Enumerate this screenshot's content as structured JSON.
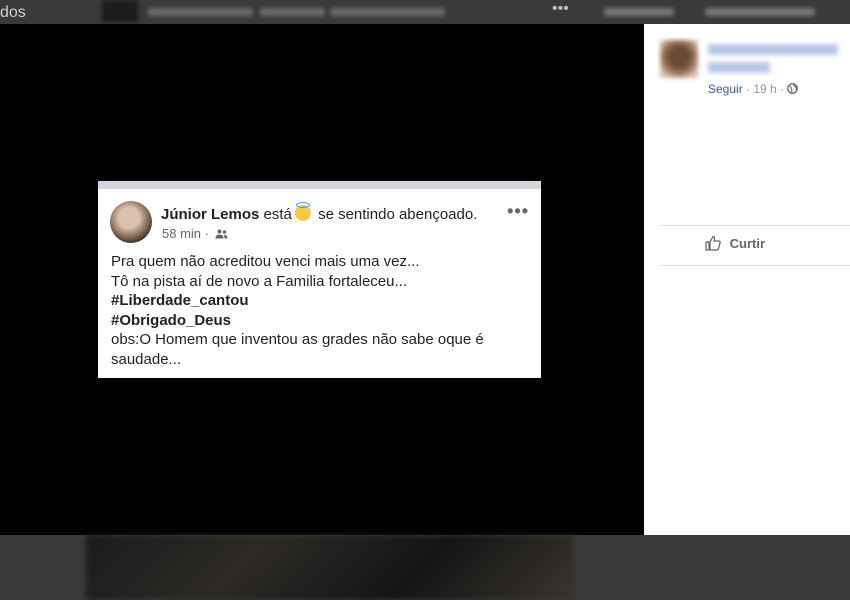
{
  "background": {
    "fragment_text": "dos"
  },
  "post": {
    "author_name": "Júnior Lemos",
    "verb": "está",
    "feeling_emoji": "halo-face-emoji",
    "feeling_text": "se sentindo abençoado.",
    "time": "58 min",
    "separator": "·",
    "audience_icon": "friends-icon",
    "more_label": "•••",
    "lines": [
      "Pra quem não acreditou venci mais uma vez...",
      "Tô na pista aí de novo a Familia fortaleceu..."
    ],
    "hashtags": [
      "#Liberdade_cantou",
      "#Obrigado_Deus"
    ],
    "closing_lines": [
      "obs:O Homem que inventou as grades não sabe oque é",
      "saudade..."
    ]
  },
  "side": {
    "follow_label": "Seguir",
    "dot": "·",
    "time": "19 h",
    "privacy_icon": "globe-icon",
    "like_label": "Curtir",
    "like_icon": "thumbs-up-icon"
  }
}
